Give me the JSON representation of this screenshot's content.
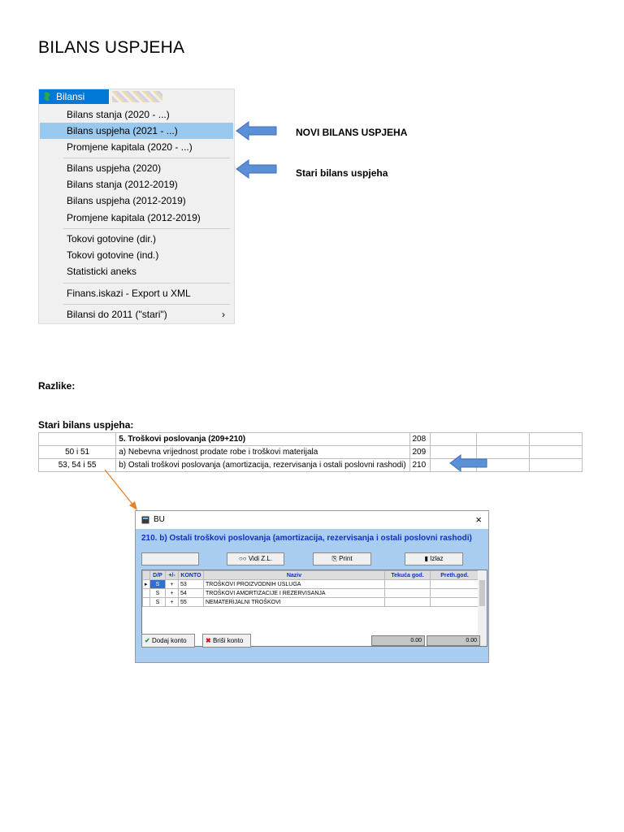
{
  "document": {
    "title": "BILANS USPJEHA"
  },
  "menu": {
    "bar_label": "Bilansi",
    "items": [
      {
        "label": "Bilans stanja (2020 - ...)"
      },
      {
        "label": "Bilans uspjeha (2021 - ...)"
      },
      {
        "label": "Promjene kapitala (2020 - ...)"
      },
      {
        "label": "Bilans uspjeha (2020)"
      },
      {
        "label": "Bilans stanja  (2012-2019)"
      },
      {
        "label": "Bilans uspjeha (2012-2019)"
      },
      {
        "label": "Promjene kapitala  (2012-2019)"
      },
      {
        "label": "Tokovi gotovine (dir.)"
      },
      {
        "label": "Tokovi gotovine (ind.)"
      },
      {
        "label": "Statisticki aneks"
      },
      {
        "label": "Finans.iskazi - Export u XML"
      },
      {
        "label": "Bilansi do 2011 (\"stari\")"
      }
    ],
    "submenu_chevron": "›"
  },
  "annotations": {
    "new": "NOVI BILANS USPJEHA",
    "old": "Stari bilans uspjeha"
  },
  "differences_label": "Razlike:",
  "old_label": "Stari bilans uspjeha:",
  "old_table": {
    "rows": [
      {
        "konto": "",
        "desc": "5. Troškovi poslovanja (209+210)",
        "code": "208"
      },
      {
        "konto": "50 i 51",
        "desc": "a) Nebevna vrijednost prodate robe i troškovi materijala",
        "code": "209"
      },
      {
        "konto": "53, 54 i 55",
        "desc": "b) Ostali troškovi poslovanja (amortizacija, rezervisanja i ostali poslovni rashodi)",
        "code": "210"
      }
    ]
  },
  "dialog": {
    "title": "BU",
    "close": "×",
    "heading": "210.  b) Ostali troškovi poslovanja (amortizacija, rezervisanja i ostali poslovni rashodi)",
    "buttons": {
      "view": "Vidi Z.L.",
      "print": "Print",
      "exit": "Izlaz"
    },
    "columns": [
      "D/P",
      "+/-",
      "KONTO",
      "Naziv",
      "Tekuća god.",
      "Preth.god."
    ],
    "rows": [
      {
        "dp": "S",
        "sign": "+",
        "konto": "53",
        "naziv": "TROŠKOVI PROIZVODNIH USLUGA"
      },
      {
        "dp": "S",
        "sign": "+",
        "konto": "54",
        "naziv": "TROŠKOVI AMORTIZACIJE I REZERVISANJA"
      },
      {
        "dp": "S",
        "sign": "+",
        "konto": "55",
        "naziv": "NEMATERIJALNI TROŠKOVI"
      }
    ],
    "add_label": "Dodaj konto",
    "delete_label": "Briši konto",
    "totals": [
      "0.00",
      "0.00"
    ]
  },
  "colors": {
    "accent": "#0078d7",
    "highlight": "#99c9ef",
    "arrow": "#5b8fd6",
    "connector": "#e8822a",
    "dialog_body": "#a9cdf0"
  }
}
